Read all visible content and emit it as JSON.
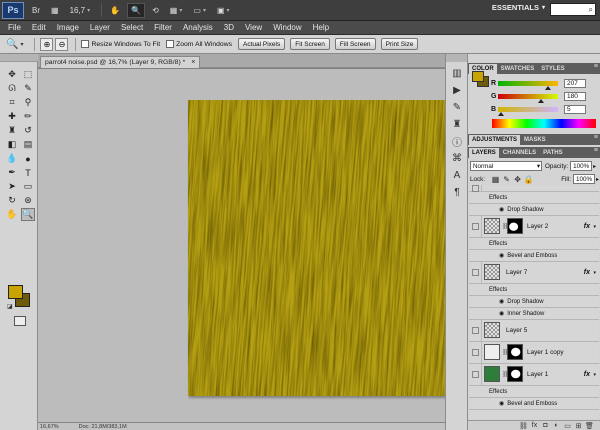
{
  "app": {
    "logo": "Ps",
    "zoom": "16,7",
    "workspace": "ESSENTIALS"
  },
  "menu": [
    "File",
    "Edit",
    "Image",
    "Layer",
    "Select",
    "Filter",
    "Analysis",
    "3D",
    "View",
    "Window",
    "Help"
  ],
  "options": {
    "resize_windows": "Resize Windows To Fit",
    "zoom_all": "Zoom All Windows",
    "actual_pixels": "Actual Pixels",
    "fit_screen": "Fit Screen",
    "fill_screen": "Fill Screen",
    "print_size": "Print Size"
  },
  "document": {
    "tab_title": "parrot4 noise.psd @ 16,7% (Layer 9, RGB/8) *",
    "status_zoom": "16,67%",
    "status_doc": "Doc: 21,8M/383,1M"
  },
  "colors": {
    "foreground": "#c9a400",
    "background": "#6d5a0b",
    "canvas": "#b59f12"
  },
  "color_panel": {
    "tabs": [
      "COLOR",
      "SWATCHES",
      "STYLES"
    ],
    "R": "207",
    "G": "180",
    "B": "5"
  },
  "adjust_tabs": [
    "ADJUSTMENTS",
    "MASKS"
  ],
  "layers_panel": {
    "tabs": [
      "LAYERS",
      "CHANNELS",
      "PATHS"
    ],
    "blend_mode": "Normal",
    "opacity_label": "Opacity:",
    "opacity": "100%",
    "lock_label": "Lock:",
    "fill_label": "Fill:",
    "fill": "100%",
    "rows": [
      {
        "kind": "effects",
        "text": "Effects"
      },
      {
        "kind": "sub",
        "text": "Drop Shadow"
      },
      {
        "kind": "layer",
        "name": "Layer 2",
        "mask": true,
        "fx": true
      },
      {
        "kind": "effects",
        "text": "Effects"
      },
      {
        "kind": "sub",
        "text": "Bevel and Emboss"
      },
      {
        "kind": "layer",
        "name": "Layer 7",
        "mask": false,
        "fx": true
      },
      {
        "kind": "effects",
        "text": "Effects"
      },
      {
        "kind": "sub",
        "text": "Drop Shadow"
      },
      {
        "kind": "sub",
        "text": "Inner Shadow"
      },
      {
        "kind": "layer",
        "name": "Layer 5",
        "mask": false,
        "fx": false
      },
      {
        "kind": "layer",
        "name": "Layer 1 copy",
        "mask": true,
        "fx": false
      },
      {
        "kind": "layer",
        "name": "Layer 1",
        "mask": true,
        "fx": true
      },
      {
        "kind": "effects",
        "text": "Effects"
      },
      {
        "kind": "sub",
        "text": "Bevel and Emboss"
      }
    ]
  }
}
